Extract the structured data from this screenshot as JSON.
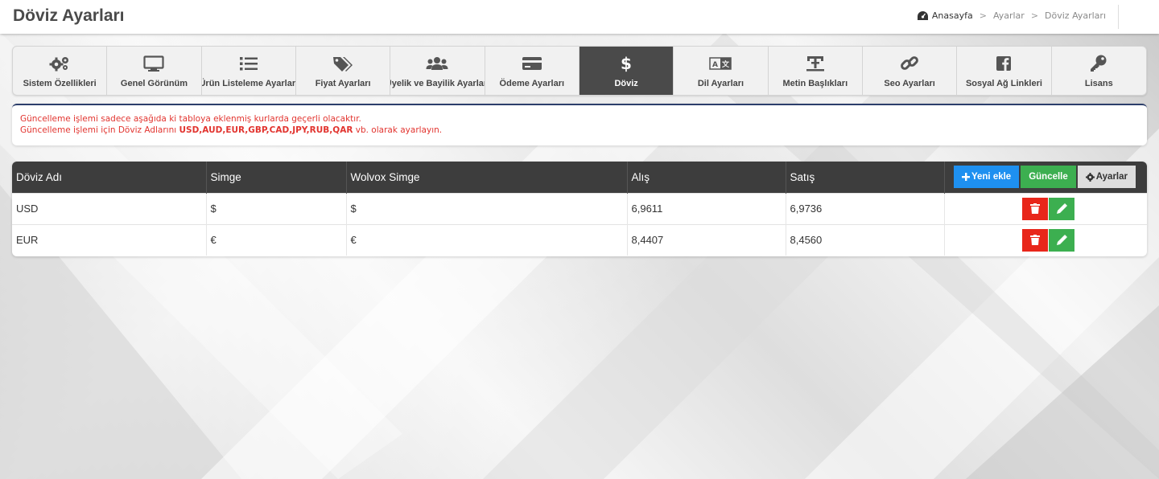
{
  "header": {
    "title": "Döviz Ayarları",
    "breadcrumb": [
      "Anasayfa",
      "Ayarlar",
      "Döviz Ayarları"
    ]
  },
  "tabs": [
    {
      "label": "Sistem Özellikleri",
      "icon": "gears-icon"
    },
    {
      "label": "Genel Görünüm",
      "icon": "monitor-icon"
    },
    {
      "label": "Ürün Listeleme Ayarları",
      "icon": "list-icon"
    },
    {
      "label": "Fiyat Ayarları",
      "icon": "tags-icon"
    },
    {
      "label": "Üyelik ve Bayilik Ayarları",
      "icon": "users-icon"
    },
    {
      "label": "Ödeme Ayarları",
      "icon": "credit-card-icon"
    },
    {
      "label": "Döviz",
      "icon": "dollar-icon",
      "active": true
    },
    {
      "label": "Dil Ayarları",
      "icon": "language-icon"
    },
    {
      "label": "Metin Başlıkları",
      "icon": "text-height-icon"
    },
    {
      "label": "Seo Ayarları",
      "icon": "link-icon"
    },
    {
      "label": "Sosyal Ağ Linkleri",
      "icon": "facebook-icon"
    },
    {
      "label": "Lisans",
      "icon": "key-icon"
    }
  ],
  "notice": {
    "line1": "Güncelleme işlemi sadece aşağıda ki tabloya eklenmiş kurlarda geçerli olacaktır.",
    "line2_prefix": "Güncelleme işlemi için Döviz Adlarını ",
    "line2_codes": "USD,AUD,EUR,GBP,CAD,JPY,RUB,QAR",
    "line2_suffix": " vb. olarak ayarlayın."
  },
  "table": {
    "columns": [
      "Döviz Adı",
      "Simge",
      "Wolvox Simge",
      "Alış",
      "Satış"
    ],
    "buttons": {
      "add": "Yeni ekle",
      "update": "Güncelle",
      "settings": "Ayarlar"
    },
    "rows": [
      {
        "name": "USD",
        "symbol": "$",
        "wolvox": "$",
        "buy": "6,9611",
        "sell": "6,9736"
      },
      {
        "name": "EUR",
        "symbol": "€",
        "wolvox": "€",
        "buy": "8,4407",
        "sell": "8,4560"
      }
    ]
  },
  "colors": {
    "active_tab": "#4a4a4a",
    "table_header": "#3d3d3d",
    "notice_text": "#e2342f",
    "add_button": "#1e90f0",
    "update_button": "#3caf50",
    "delete_button": "#e8261a",
    "edit_button": "#3caf50"
  }
}
